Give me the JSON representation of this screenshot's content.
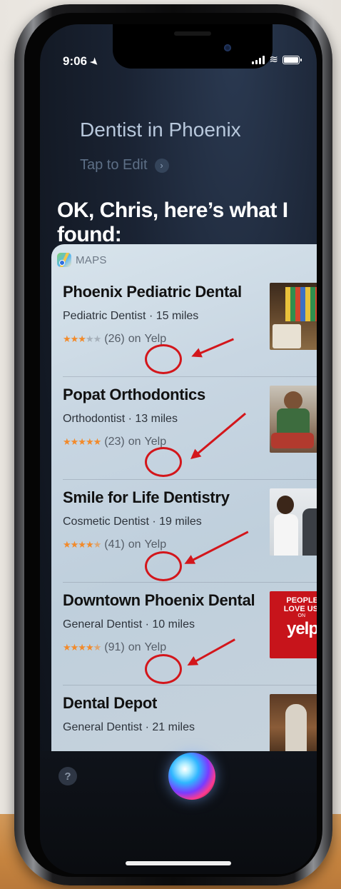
{
  "status": {
    "time": "9:06"
  },
  "siri": {
    "query": "Dentist in Phoenix",
    "tap_to_edit": "Tap to Edit",
    "response": "OK, Chris, here’s what I found:"
  },
  "card": {
    "source_label": "MAPS",
    "results": [
      {
        "name": "Phoenix Pediatric Dental",
        "subtitle": "Pediatric Dentist · 15 miles",
        "stars": 3,
        "count": "(26)",
        "on": "on",
        "source": "Yelp"
      },
      {
        "name": "Popat Orthodontics",
        "subtitle": "Orthodontist · 13 miles",
        "stars": 5,
        "count": "(23)",
        "on": "on",
        "source": "Yelp"
      },
      {
        "name": "Smile for Life Dentistry",
        "subtitle": "Cosmetic Dentist · 19 miles",
        "stars": 4.5,
        "count": "(41)",
        "on": "on",
        "source": "Yelp"
      },
      {
        "name": "Downtown Phoenix Dental",
        "subtitle": "General Dentist · 10 miles",
        "stars": 4.5,
        "count": "(91)",
        "on": "on",
        "source": "Yelp"
      },
      {
        "name": "Dental Depot",
        "subtitle": "General Dentist · 21 miles"
      }
    ],
    "thumb4_text": {
      "line1": "PEOPLE",
      "line2": "LOVE US",
      "line3": "ON",
      "brand": "yelp"
    }
  },
  "help_label": "?",
  "colors": {
    "annotation_red": "#d3161b",
    "star_orange": "#f28a2a"
  }
}
